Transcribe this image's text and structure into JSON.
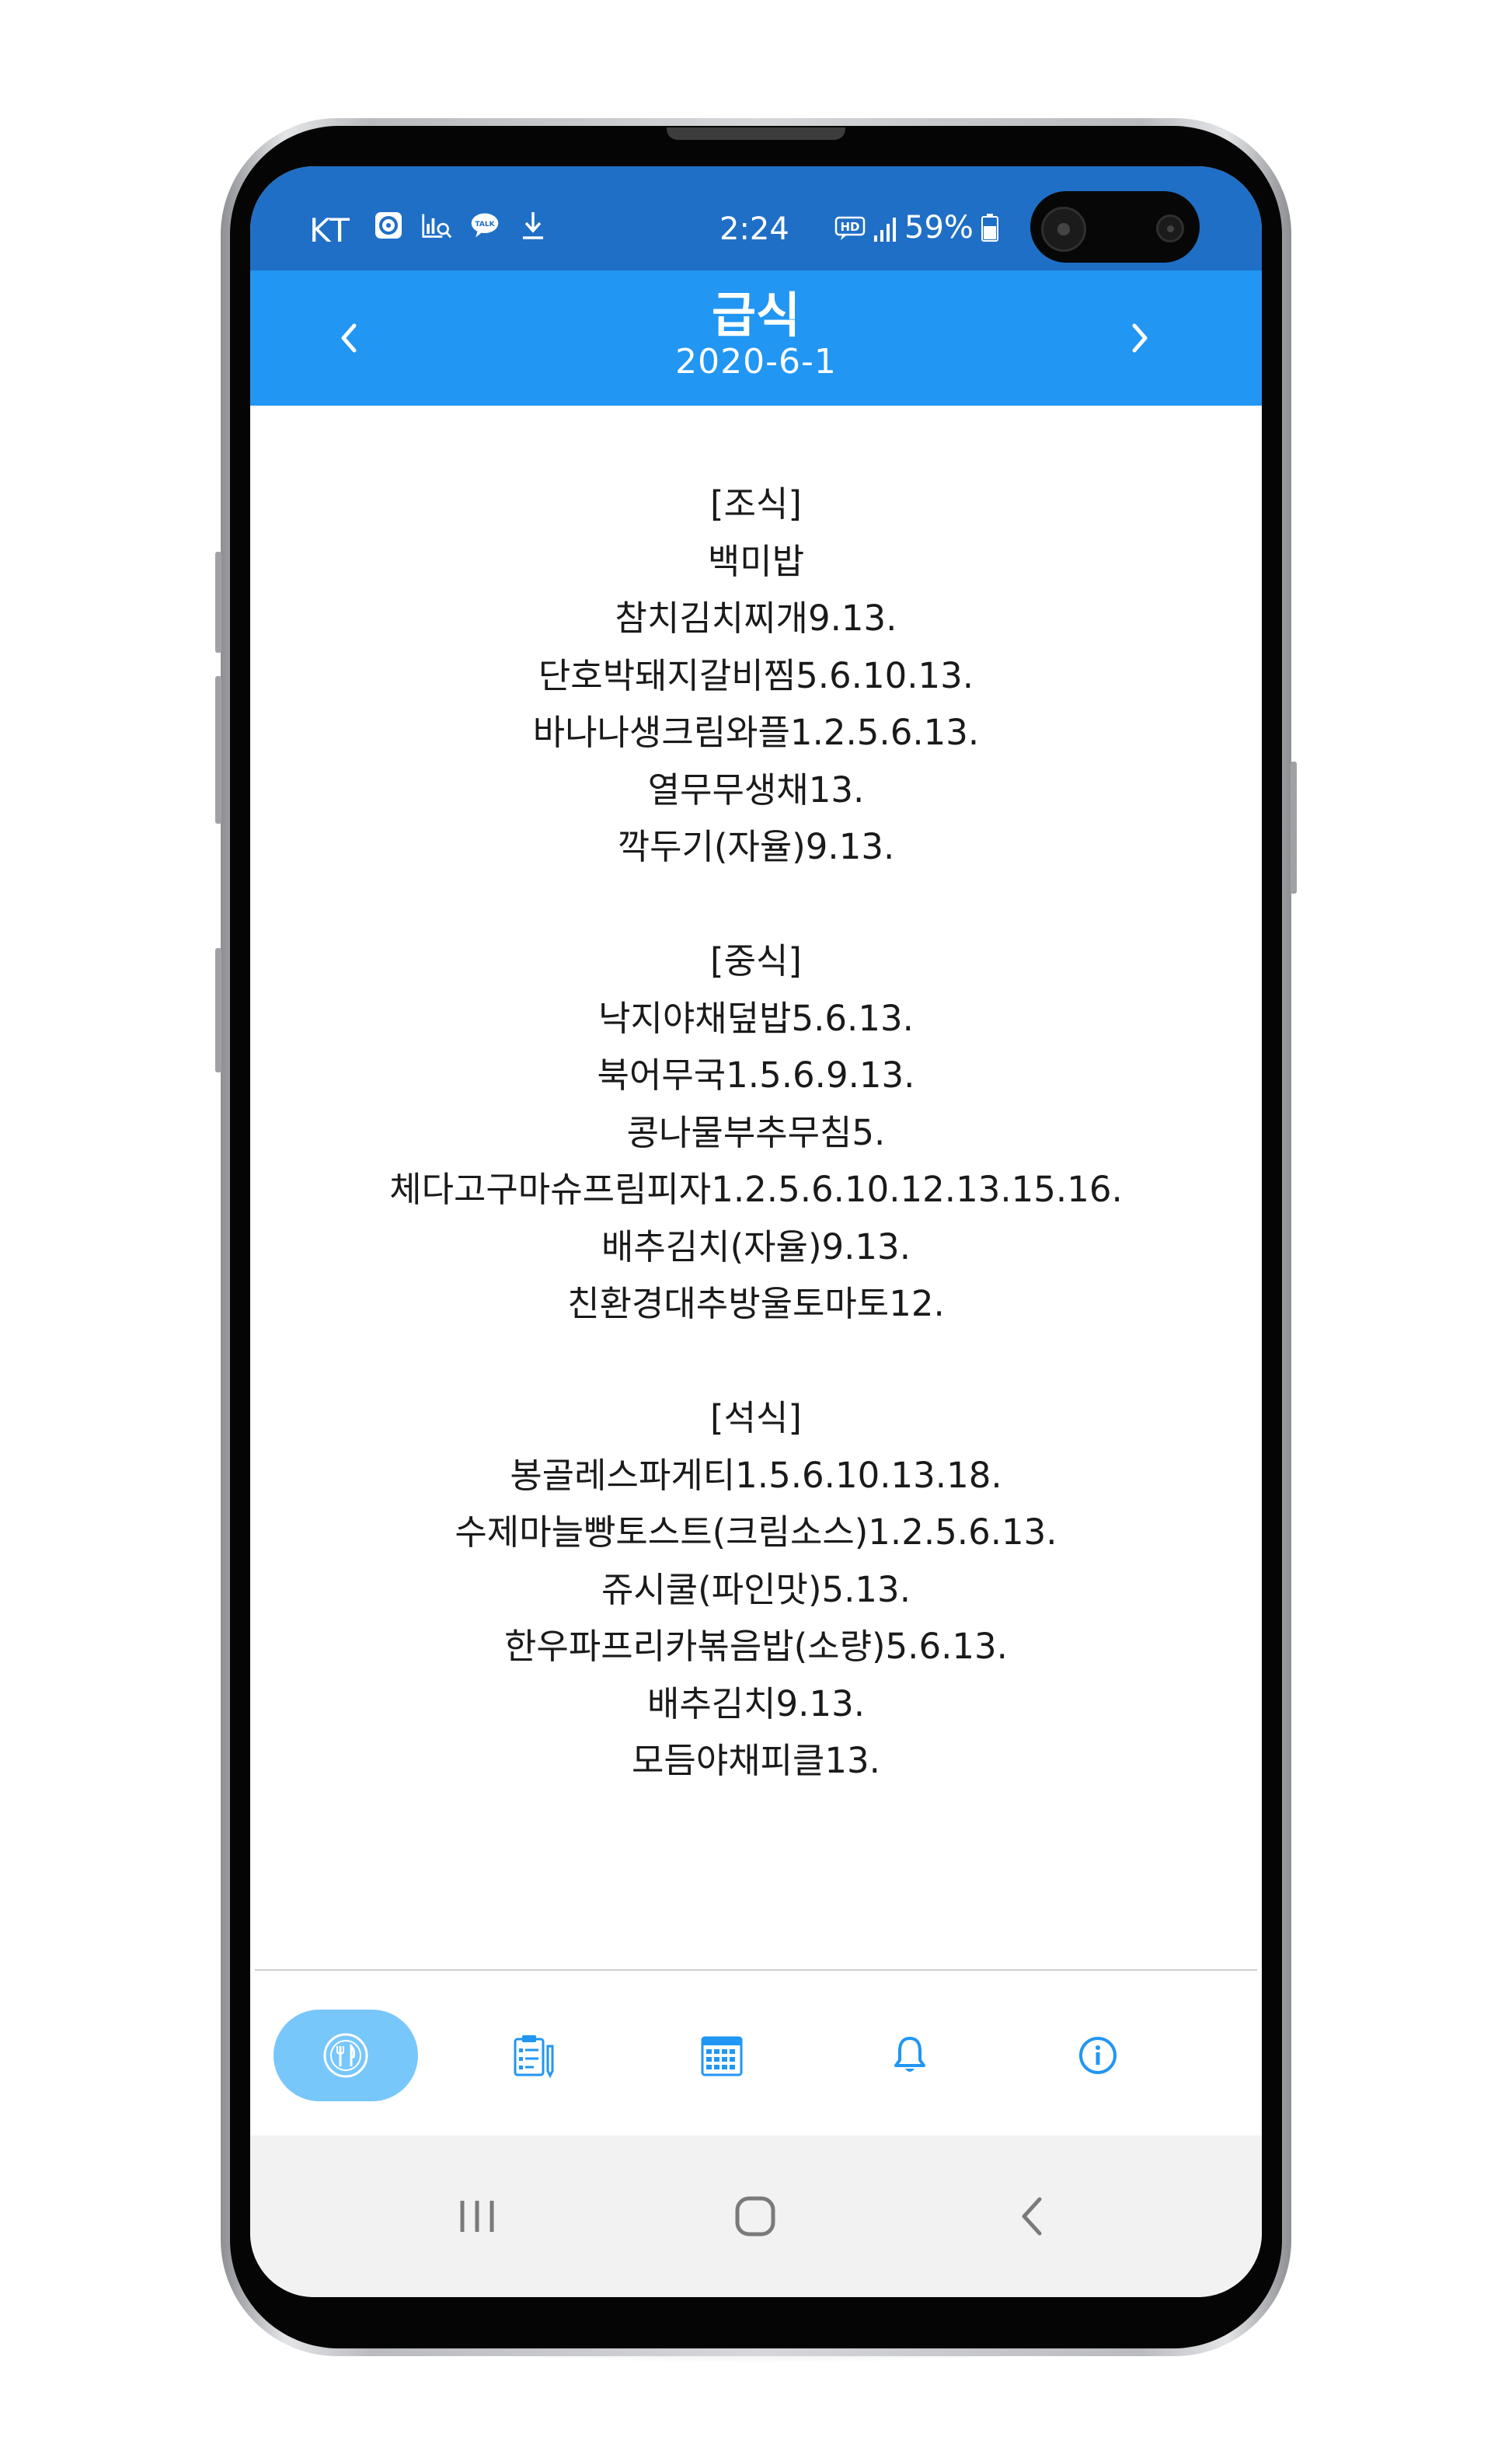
{
  "status_bar": {
    "carrier": "KT",
    "time": "2:24",
    "battery": "59%",
    "hd": "HD",
    "notification_icons": [
      "cloud-app-icon",
      "report-search-icon",
      "kakaotalk-icon",
      "download-icon"
    ]
  },
  "app_bar": {
    "title": "급식",
    "date": "2020-6-1",
    "prev_icon": "chevron-left-icon",
    "next_icon": "chevron-right-icon"
  },
  "meals": [
    {
      "header": "[조식]",
      "items": [
        "백미밥",
        "참치김치찌개9.13.",
        "단호박돼지갈비찜5.6.10.13.",
        "바나나생크림와플1.2.5.6.13.",
        "열무무생채13.",
        "깍두기(자율)9.13."
      ]
    },
    {
      "header": "[중식]",
      "items": [
        "낙지야채덮밥5.6.13.",
        "북어무국1.5.6.9.13.",
        "콩나물부추무침5.",
        "체다고구마슈프림피자1.2.5.6.10.12.13.15.16.",
        "배추김치(자율)9.13.",
        "친환경대추방울토마토12."
      ]
    },
    {
      "header": "[석식]",
      "items": [
        "봉골레스파게티1.5.6.10.13.18.",
        "수제마늘빵토스트(크림소스)1.2.5.6.13.",
        "쥬시쿨(파인맛)5.13.",
        "한우파프리카볶음밥(소량)5.6.13.",
        "배추김치9.13.",
        "모듬야채피클13."
      ]
    }
  ],
  "bottom_nav": {
    "tabs": [
      {
        "icon": "meal-icon",
        "active": true
      },
      {
        "icon": "clipboard-icon",
        "active": false
      },
      {
        "icon": "calendar-icon",
        "active": false
      },
      {
        "icon": "bell-icon",
        "active": false
      },
      {
        "icon": "info-icon",
        "active": false
      }
    ]
  },
  "system_nav": {
    "buttons": [
      "recent-apps-icon",
      "home-icon",
      "back-icon"
    ]
  },
  "colors": {
    "status_bar": "#1f6fc6",
    "app_bar": "#2196f3",
    "active_tab": "#78c7fb",
    "icon_blue": "#2196f3",
    "system_nav_bg": "#f2f2f2"
  }
}
